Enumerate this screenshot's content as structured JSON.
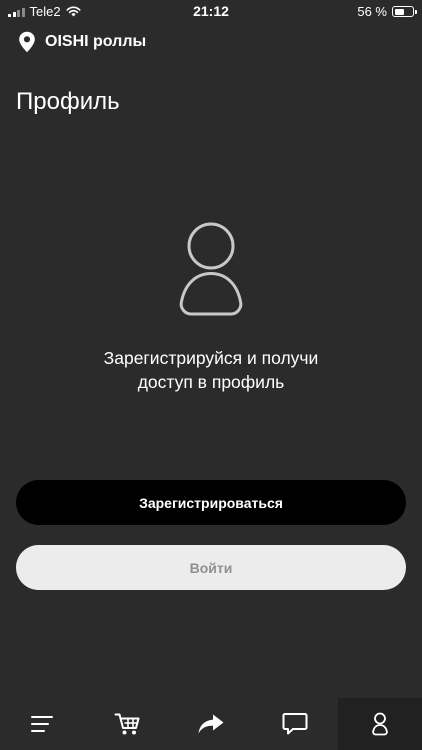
{
  "status_bar": {
    "carrier": "Tele2",
    "time": "21:12",
    "battery_text": "56 %",
    "battery_level": 0.56
  },
  "location": {
    "name": "OISHI роллы",
    "icon": "map-pin-icon"
  },
  "page": {
    "title": "Профиль"
  },
  "empty_state": {
    "icon": "user-icon",
    "line1": "Зарегистрируйся и получи",
    "line2": "доступ в профиль"
  },
  "buttons": {
    "register_label": "Зарегистрироваться",
    "login_label": "Войти"
  },
  "tabbar": {
    "items": [
      {
        "icon": "menu-icon"
      },
      {
        "icon": "cart-icon"
      },
      {
        "icon": "share-arrow-icon"
      },
      {
        "icon": "chat-icon"
      },
      {
        "icon": "user-icon",
        "active": true
      }
    ]
  },
  "colors": {
    "background": "#2b2b2b",
    "primary_button": "#000000",
    "secondary_button": "#ececec",
    "secondary_button_text": "#8f8f8f",
    "active_tab": "#212121"
  }
}
